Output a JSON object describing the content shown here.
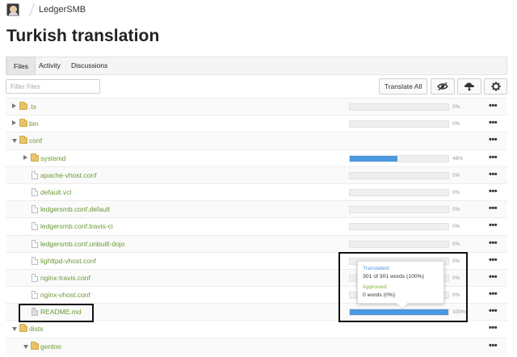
{
  "breadcrumb": {
    "project": "LedgerSMB"
  },
  "page": {
    "title": "Turkish translation"
  },
  "tabs": [
    {
      "label": "Files",
      "active": true
    },
    {
      "label": "Activity",
      "active": false
    },
    {
      "label": "Discussions",
      "active": false
    }
  ],
  "toolbar": {
    "filter_placeholder": "Filter Files",
    "translate_all_label": "Translate All",
    "icons": [
      "hide-icon",
      "cloud-icon",
      "gear-icon"
    ]
  },
  "files": [
    {
      "name": ".tx",
      "type": "folder",
      "state": "collapsed",
      "depth": 0,
      "progress": 0,
      "percent": "0%"
    },
    {
      "name": "bin",
      "type": "folder",
      "state": "collapsed",
      "depth": 0,
      "progress": 0,
      "percent": "0%"
    },
    {
      "name": "conf",
      "type": "folder",
      "state": "expanded",
      "depth": 0,
      "progress": null,
      "percent": ""
    },
    {
      "name": "systemd",
      "type": "folder",
      "state": "collapsed",
      "depth": 1,
      "progress": 48,
      "percent": "48%"
    },
    {
      "name": "apache-vhost.conf",
      "type": "file",
      "depth": 1,
      "progress": 0,
      "percent": "0%"
    },
    {
      "name": "default.vcl",
      "type": "file",
      "depth": 1,
      "progress": 0,
      "percent": "0%"
    },
    {
      "name": "ledgersmb.conf.default",
      "type": "file",
      "depth": 1,
      "progress": 0,
      "percent": "0%"
    },
    {
      "name": "ledgersmb.conf.travis-ci",
      "type": "file",
      "depth": 1,
      "progress": 0,
      "percent": "0%"
    },
    {
      "name": "ledgersmb.conf.unbuilt-dojo",
      "type": "file",
      "depth": 1,
      "progress": 0,
      "percent": "0%"
    },
    {
      "name": "lighttpd-vhost.conf",
      "type": "file",
      "depth": 1,
      "progress": 0,
      "percent": "0%"
    },
    {
      "name": "nginx-travis.conf",
      "type": "file",
      "depth": 1,
      "progress": 0,
      "percent": "0%"
    },
    {
      "name": "nginx-vhost.conf",
      "type": "file",
      "depth": 1,
      "progress": 0,
      "percent": "0%"
    },
    {
      "name": "README.md",
      "type": "file-md",
      "depth": 1,
      "progress": 100,
      "percent": "100%"
    },
    {
      "name": "dists",
      "type": "folder",
      "state": "expanded",
      "depth": 0,
      "progress": null,
      "percent": ""
    },
    {
      "name": "gentoo",
      "type": "folder",
      "state": "expanded",
      "depth": 1,
      "progress": null,
      "percent": ""
    }
  ],
  "tooltip": {
    "translated_label": "Translated:",
    "translated_value": "301 of 301 words (100%)",
    "approved_label": "Approved:",
    "approved_value": "0 words (0%)"
  },
  "colors": {
    "accent": "#4a98e0",
    "file_link": "#6a9a35",
    "approved": "#7ab43c"
  }
}
